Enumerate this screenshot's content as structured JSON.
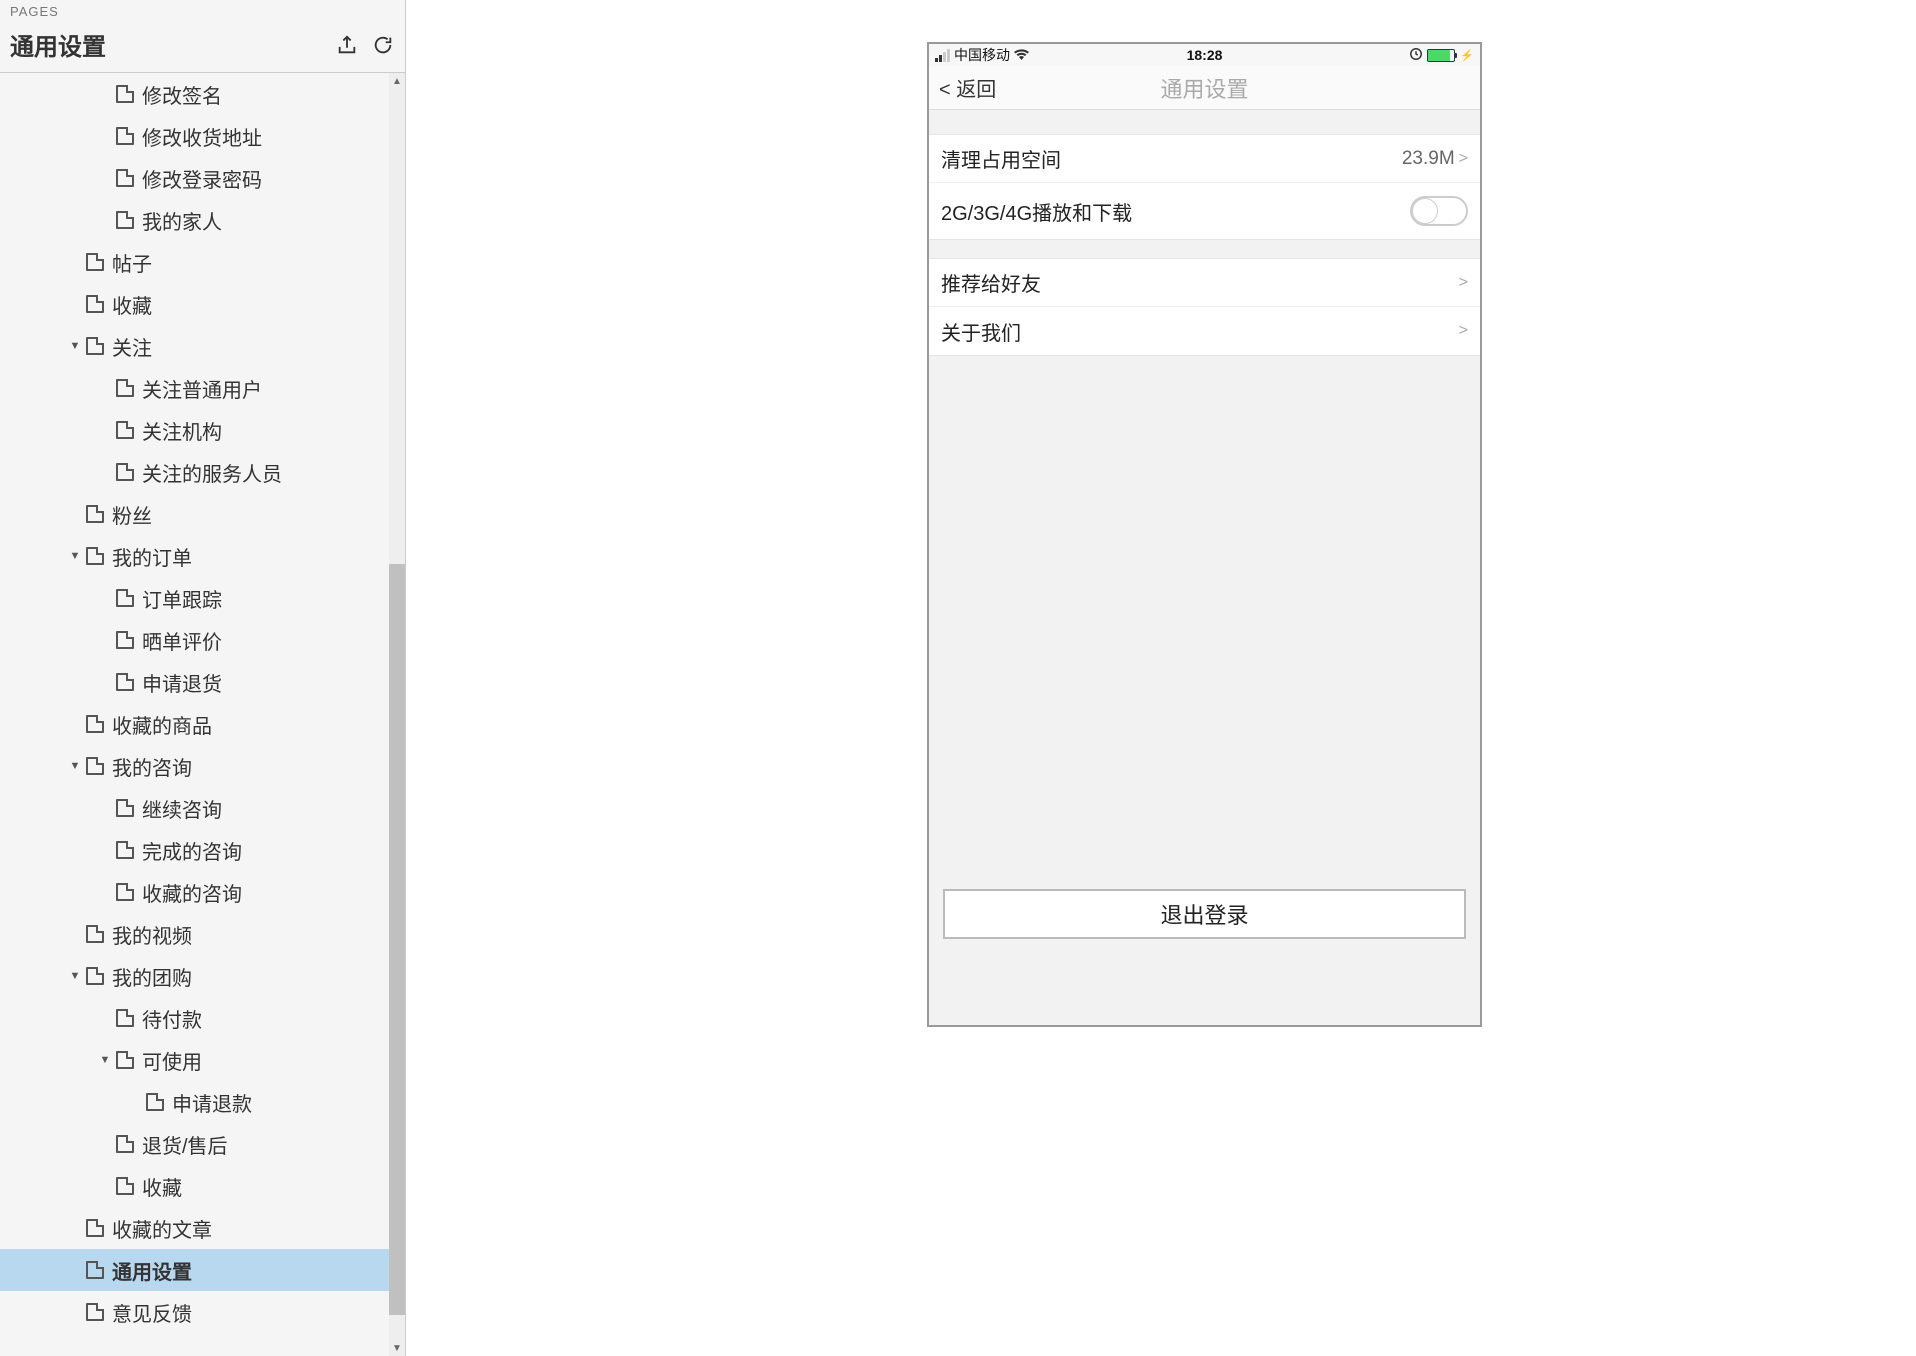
{
  "sidebar": {
    "section_label": "PAGES",
    "title": "通用设置",
    "tree": [
      {
        "label": "修改签名",
        "indent": 3,
        "expandable": false
      },
      {
        "label": "修改收货地址",
        "indent": 3,
        "expandable": false
      },
      {
        "label": "修改登录密码",
        "indent": 3,
        "expandable": false
      },
      {
        "label": "我的家人",
        "indent": 3,
        "expandable": false
      },
      {
        "label": "帖子",
        "indent": 2,
        "expandable": false
      },
      {
        "label": "收藏",
        "indent": 2,
        "expandable": false
      },
      {
        "label": "关注",
        "indent": 2,
        "expandable": true,
        "expanded": true
      },
      {
        "label": "关注普通用户",
        "indent": 3,
        "expandable": false
      },
      {
        "label": "关注机构",
        "indent": 3,
        "expandable": false
      },
      {
        "label": "关注的服务人员",
        "indent": 3,
        "expandable": false
      },
      {
        "label": "粉丝",
        "indent": 2,
        "expandable": false
      },
      {
        "label": "我的订单",
        "indent": 2,
        "expandable": true,
        "expanded": true
      },
      {
        "label": "订单跟踪",
        "indent": 3,
        "expandable": false
      },
      {
        "label": "晒单评价",
        "indent": 3,
        "expandable": false
      },
      {
        "label": "申请退货",
        "indent": 3,
        "expandable": false
      },
      {
        "label": "收藏的商品",
        "indent": 2,
        "expandable": false
      },
      {
        "label": "我的咨询",
        "indent": 2,
        "expandable": true,
        "expanded": true
      },
      {
        "label": "继续咨询",
        "indent": 3,
        "expandable": false
      },
      {
        "label": "完成的咨询",
        "indent": 3,
        "expandable": false
      },
      {
        "label": "收藏的咨询",
        "indent": 3,
        "expandable": false
      },
      {
        "label": "我的视频",
        "indent": 2,
        "expandable": false
      },
      {
        "label": "我的团购",
        "indent": 2,
        "expandable": true,
        "expanded": true
      },
      {
        "label": "待付款",
        "indent": 3,
        "expandable": false
      },
      {
        "label": "可使用",
        "indent": 3,
        "expandable": true,
        "expanded": true
      },
      {
        "label": "申请退款",
        "indent": 4,
        "expandable": false
      },
      {
        "label": "退货/售后",
        "indent": 3,
        "expandable": false
      },
      {
        "label": "收藏",
        "indent": 3,
        "expandable": false
      },
      {
        "label": "收藏的文章",
        "indent": 2,
        "expandable": false
      },
      {
        "label": "通用设置",
        "indent": 2,
        "expandable": false,
        "selected": true
      },
      {
        "label": "意见反馈",
        "indent": 2,
        "expandable": false
      }
    ]
  },
  "phone": {
    "statusbar": {
      "carrier": "中国移动",
      "time": "18:28"
    },
    "navbar": {
      "back": "< 返回",
      "title": "通用设置"
    },
    "cells": {
      "clear_space": {
        "label": "清理占用空间",
        "value": "23.9M"
      },
      "network_toggle": {
        "label": "2G/3G/4G播放和下载"
      },
      "recommend": {
        "label": "推荐给好友"
      },
      "about": {
        "label": "关于我们"
      }
    },
    "logout": "退出登录"
  }
}
